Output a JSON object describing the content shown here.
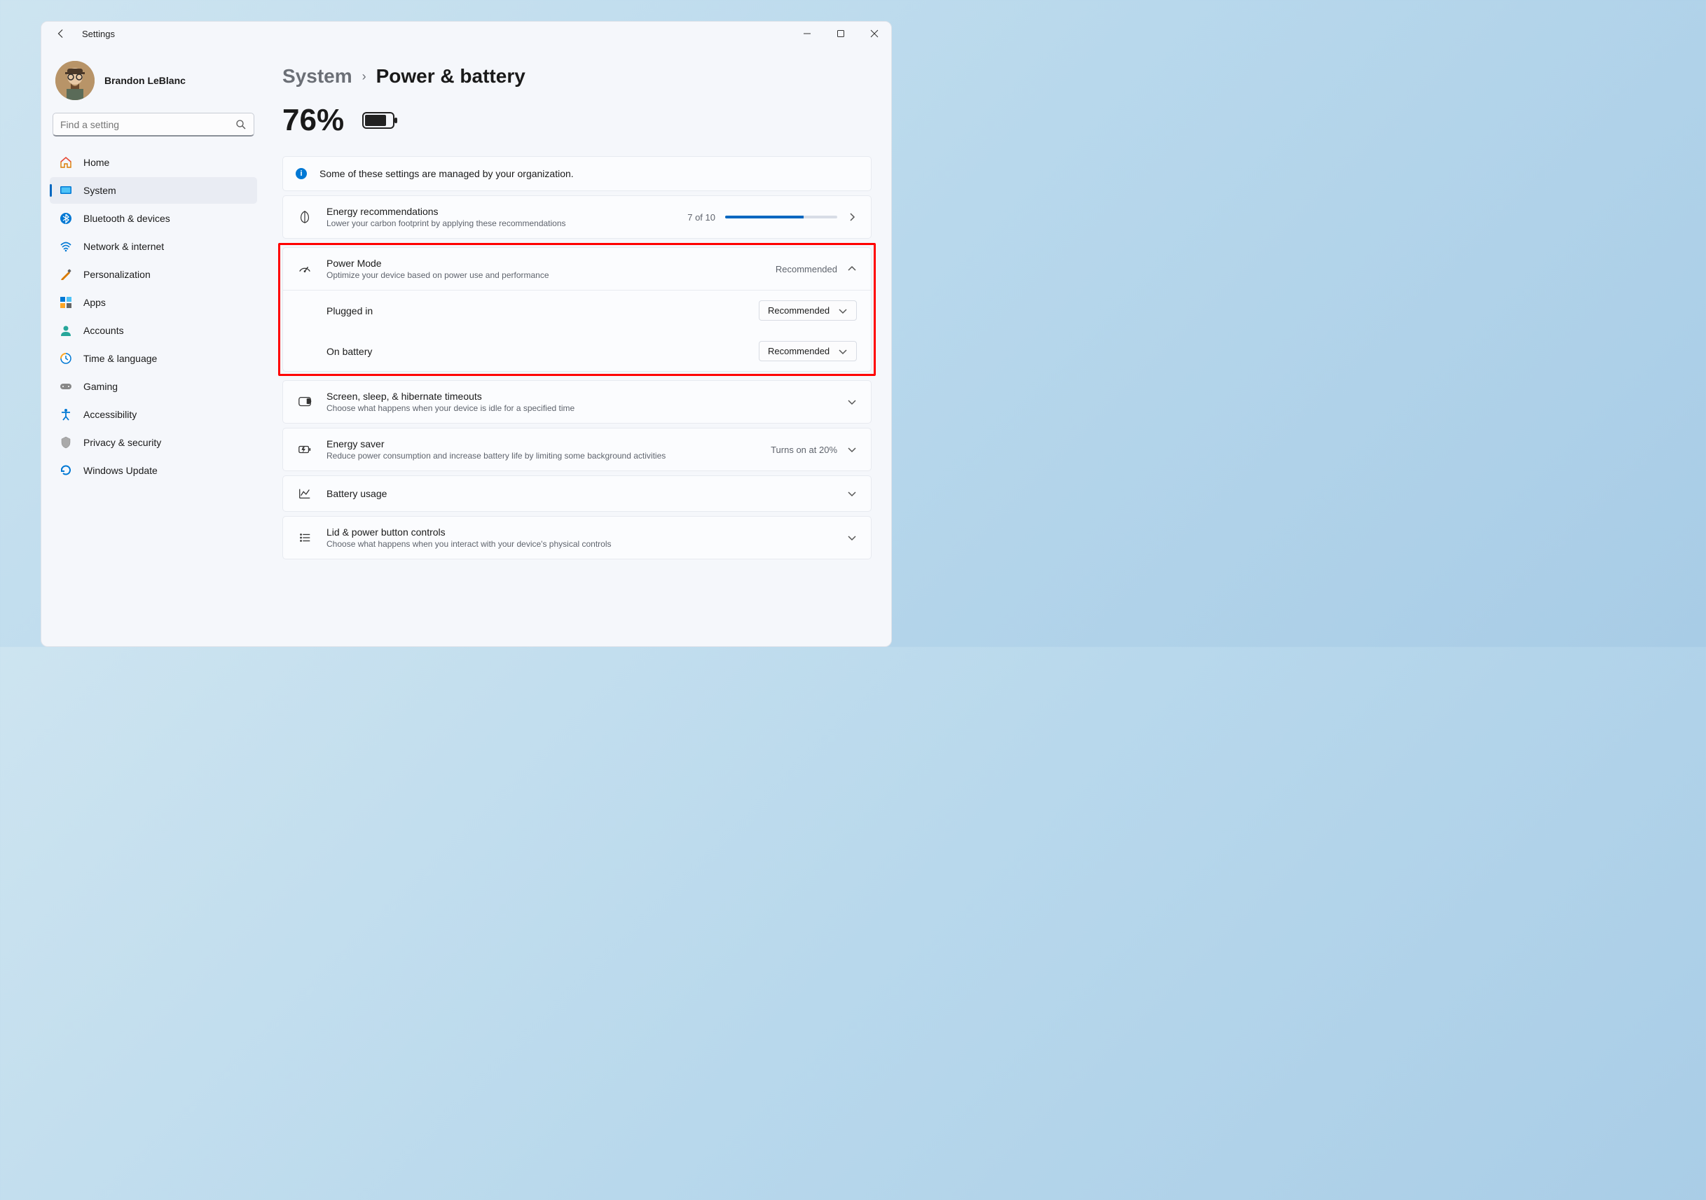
{
  "window": {
    "title": "Settings"
  },
  "user": {
    "name": "Brandon LeBlanc"
  },
  "search": {
    "placeholder": "Find a setting"
  },
  "nav": {
    "home": "Home",
    "system": "System",
    "bluetooth": "Bluetooth & devices",
    "network": "Network & internet",
    "personalization": "Personalization",
    "apps": "Apps",
    "accounts": "Accounts",
    "time": "Time & language",
    "gaming": "Gaming",
    "accessibility": "Accessibility",
    "privacy": "Privacy & security",
    "update": "Windows Update"
  },
  "breadcrumb": {
    "parent": "System",
    "current": "Power & battery"
  },
  "battery": {
    "percent": "76%"
  },
  "banner": {
    "text": "Some of these settings are managed by your organization."
  },
  "energy_rec": {
    "title": "Energy recommendations",
    "sub": "Lower your carbon footprint by applying these recommendations",
    "count": "7 of 10",
    "progress_pct": 70
  },
  "power_mode": {
    "title": "Power Mode",
    "sub": "Optimize your device based on power use and performance",
    "value": "Recommended",
    "plugged_label": "Plugged in",
    "plugged_value": "Recommended",
    "battery_label": "On battery",
    "battery_value": "Recommended"
  },
  "screen_sleep": {
    "title": "Screen, sleep, & hibernate timeouts",
    "sub": "Choose what happens when your device is idle for a specified time"
  },
  "energy_saver": {
    "title": "Energy saver",
    "sub": "Reduce power consumption and increase battery life by limiting some background activities",
    "value": "Turns on at 20%"
  },
  "battery_usage": {
    "title": "Battery usage"
  },
  "lid": {
    "title": "Lid & power button controls",
    "sub": "Choose what happens when you interact with your device's physical controls"
  }
}
